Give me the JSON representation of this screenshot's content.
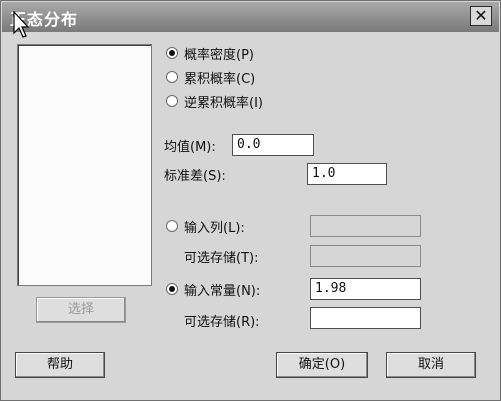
{
  "window": {
    "title": "正态分布",
    "close_glyph": "✕"
  },
  "left_panel": {
    "select_button": "选择"
  },
  "distribution": {
    "options": [
      {
        "label": "概率密度(P)",
        "selected": true
      },
      {
        "label": "累积概率(C)",
        "selected": false
      },
      {
        "label": "逆累积概率(I)",
        "selected": false
      }
    ]
  },
  "params": {
    "mean_label": "均值(M):",
    "mean_value": "0.0",
    "sd_label": "标准差(S):",
    "sd_value": "1.0"
  },
  "input": {
    "column_label": "输入列(L):",
    "column_value": "",
    "column_store_label": "可选存储(T):",
    "column_store_value": "",
    "constant_label": "输入常量(N):",
    "constant_value": "1.98",
    "constant_store_label": "可选存储(R):",
    "constant_store_value": "",
    "mode": "constant"
  },
  "footer": {
    "help": "帮助",
    "ok": "确定(O)",
    "cancel": "取消"
  },
  "colors": {
    "titlebar": "#8a8a8a",
    "dialog_bg": "#d6d6d6"
  },
  "icons": {
    "cursor": "arrow-cursor-icon",
    "close": "close-icon"
  }
}
